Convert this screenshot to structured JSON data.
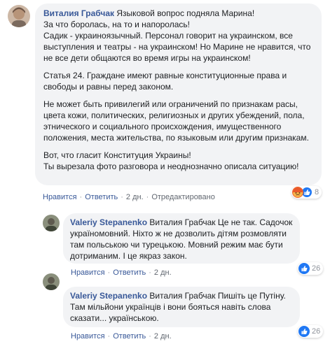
{
  "comments": [
    {
      "author": "Виталия Грабчак",
      "paragraphs": [
        "Языковой вопрос подняла Марина!\nЗа что боролась, на то и напоролась!\nСадик - украиноязычный. Персонал говорит на украинском, все выступления и театры - на украинском! Но Марине не нравится, что не все дети общаются во время игры на украинском!",
        "Статья 24. Граждане имеют равные конституционные права и свободы и равны перед законом.",
        "Не может быть привилегий или ограничений по признакам расы, цвета кожи, политических, религиозных и других убеждений, пола, этнического и социального происхождения, имущественного положения, места жительства, по языковым или другим признакам.",
        "Вот, что гласит Конституция Украины!\nТы вырезала фото разговора и неоднозначно описала ситуацию!"
      ],
      "actions": {
        "like": "Нравится",
        "reply": "Ответить",
        "time": "2 дн.",
        "edited": "Отредактировано"
      },
      "reactions": {
        "icons": [
          "angry-icon",
          "like-icon"
        ],
        "count": "8"
      }
    },
    {
      "author": "Valeriy Stepanenko",
      "text": "Виталия Грабчак Це не так. Садочок україномовний. Ніхто ж не дозволить дітям розмовляти там польською чи турецькою. Мовний режим має бути дотриманим. І це якраз закон.",
      "actions": {
        "like": "Нравится",
        "reply": "Ответить",
        "time": "2 дн."
      },
      "reactions": {
        "icons": [
          "like-icon"
        ],
        "count": "26"
      }
    },
    {
      "author": "Valeriy Stepanenko",
      "text": "Виталия Грабчак Пишіть це Путіну. Там мільйони українців і вони бояться навіть слова сказати... українською.",
      "actions": {
        "like": "Нравится",
        "reply": "Ответить",
        "time": "2 дн."
      },
      "reactions": {
        "icons": [
          "like-icon"
        ],
        "count": "26"
      }
    }
  ],
  "colors": {
    "like_blue": "#2078f4",
    "angry_orange": "#f0652f",
    "link": "#385898",
    "bubble": "#f2f3f5"
  }
}
